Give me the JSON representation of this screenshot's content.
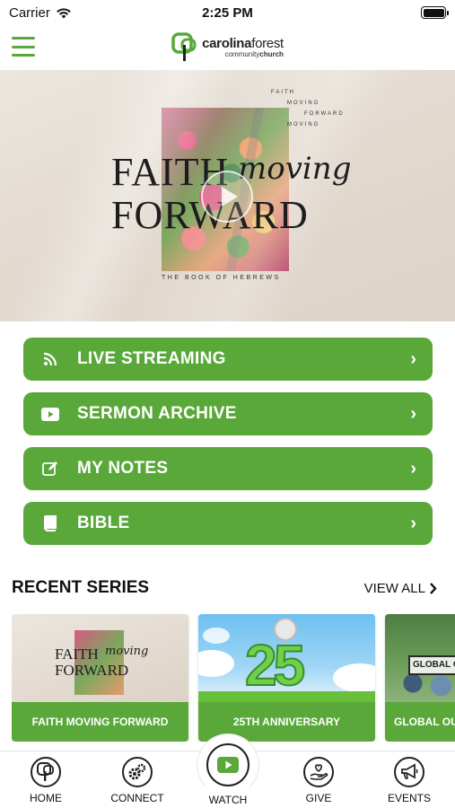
{
  "status_bar": {
    "carrier": "Carrier",
    "time": "2:25 PM"
  },
  "header": {
    "logo_main": "carolina",
    "logo_main_2": "forest",
    "logo_sub": "community",
    "logo_sub_2": "church"
  },
  "hero": {
    "title_line1": "FAITH",
    "title_script": "moving",
    "title_line2": "FORWARD",
    "small_1": "FAITH",
    "small_2": "MOVING",
    "small_3": "FORWARD",
    "small_4": "MOVING",
    "caption": "THE BOOK OF HEBREWS"
  },
  "menu": {
    "items": [
      {
        "label": "LIVE STREAMING",
        "icon": "rss-icon"
      },
      {
        "label": "SERMON ARCHIVE",
        "icon": "youtube-icon"
      },
      {
        "label": "MY NOTES",
        "icon": "edit-icon"
      },
      {
        "label": "BIBLE",
        "icon": "book-icon"
      }
    ]
  },
  "recent_series": {
    "title": "RECENT SERIES",
    "view_all": "VIEW ALL",
    "cards": [
      {
        "label": "FAITH MOVING FORWARD",
        "mini_title_1": "FAITH",
        "mini_title_2": "FORWARD",
        "mini_script": "moving"
      },
      {
        "label": "25TH ANNIVERSARY",
        "number": "25"
      },
      {
        "label": "GLOBAL OU",
        "sign_text": "GLOBAL O"
      }
    ]
  },
  "bottom_nav": {
    "home": "HOME",
    "connect": "CONNECT",
    "watch": "WATCH",
    "give": "GIVE",
    "events": "EVENTS"
  },
  "colors": {
    "brand_green": "#5aa83a"
  }
}
